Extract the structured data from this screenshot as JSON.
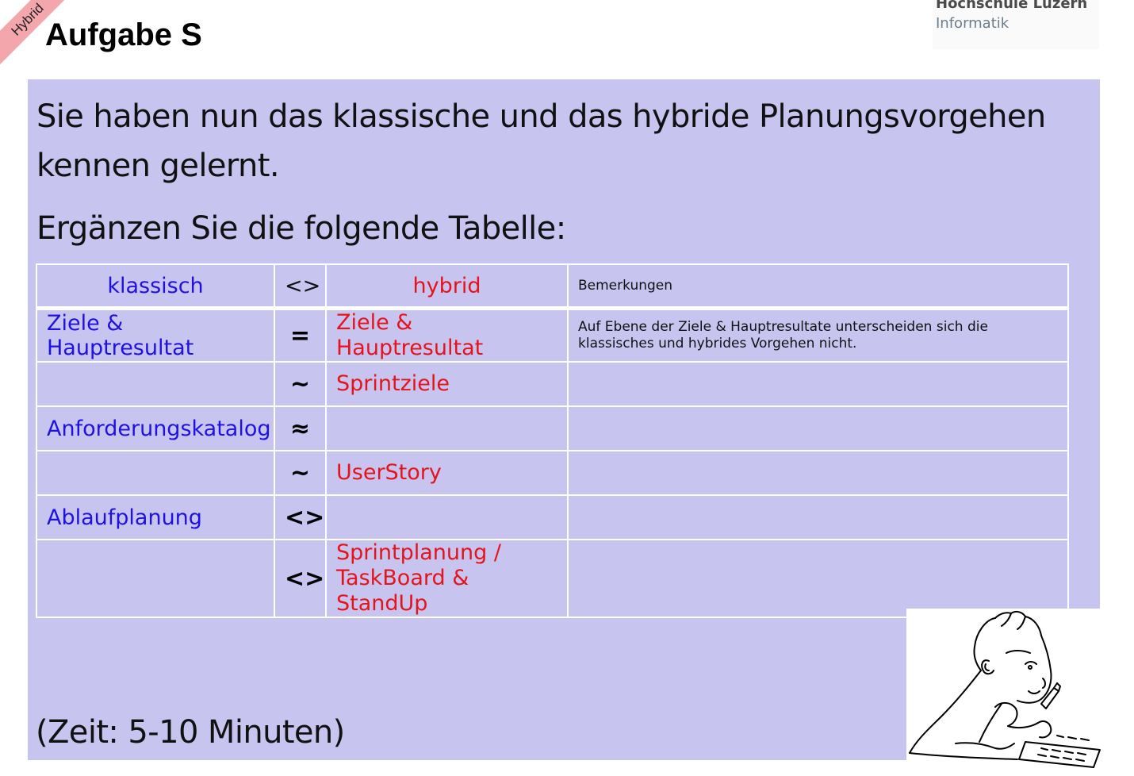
{
  "ribbon": {
    "label": "Hybrid"
  },
  "title": "Aufgabe S",
  "logo": {
    "line1": "Hochschule Luzern",
    "line2": "Informatik"
  },
  "intro": "Sie haben nun das klassische und das hybride Planungsvorgehen kennen gelernt.",
  "instruction": "Ergänzen Sie die folgende Tabelle:",
  "table": {
    "headers": {
      "klassisch": "klassisch",
      "symbol": "<>",
      "hybrid": "hybrid",
      "remarks": "Bemerkungen"
    },
    "rows": [
      {
        "klassisch": "Ziele & Hauptresultat",
        "symbol": "=",
        "hybrid": "Ziele & Hauptresultat",
        "remark": "Auf Ebene der Ziele & Hauptresultate unterscheiden sich die klassisches und hybrides Vorgehen nicht."
      },
      {
        "klassisch": "",
        "symbol": "~",
        "hybrid": "Sprintziele",
        "remark": ""
      },
      {
        "klassisch": "Anforderungskatalog",
        "symbol": "≈",
        "hybrid": "",
        "remark": ""
      },
      {
        "klassisch": "",
        "symbol": "~",
        "hybrid": "UserStory",
        "remark": ""
      },
      {
        "klassisch": "Ablaufplanung",
        "symbol": "<>",
        "hybrid": "",
        "remark": ""
      },
      {
        "klassisch": "",
        "symbol": "<>",
        "hybrid": "Sprintplanung / TaskBoard & StandUp",
        "remark": ""
      }
    ]
  },
  "time_note": "(Zeit: 5-10 Minuten)",
  "illustration": {
    "icon": "child-writing-icon"
  }
}
